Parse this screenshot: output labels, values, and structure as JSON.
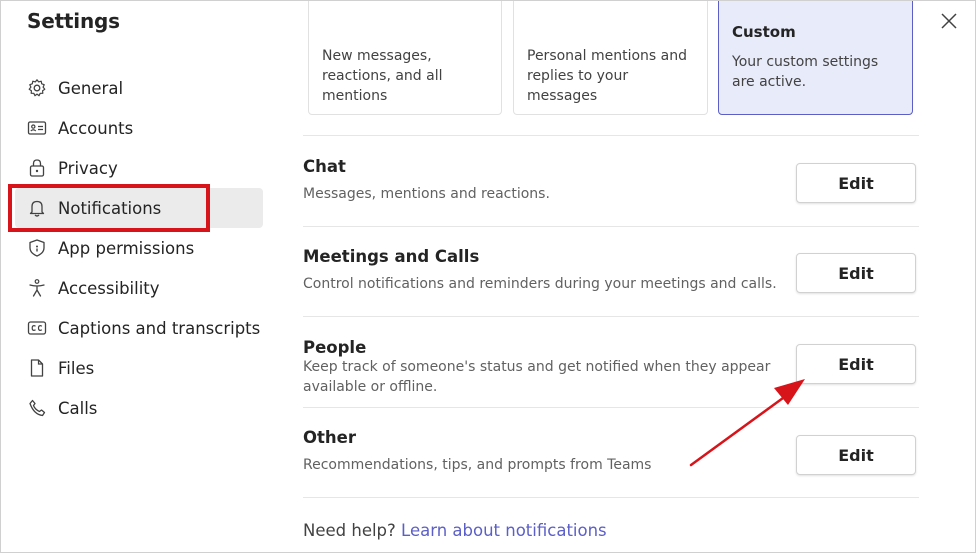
{
  "window": {
    "title": "Settings"
  },
  "sidebar": {
    "items": [
      {
        "label": "General",
        "icon": "gear-icon"
      },
      {
        "label": "Accounts",
        "icon": "id-card-icon"
      },
      {
        "label": "Privacy",
        "icon": "lock-icon"
      },
      {
        "label": "Notifications",
        "icon": "bell-icon",
        "active": true
      },
      {
        "label": "App permissions",
        "icon": "shield-icon"
      },
      {
        "label": "Accessibility",
        "icon": "accessibility-icon"
      },
      {
        "label": "Captions and transcripts",
        "icon": "cc-icon"
      },
      {
        "label": "Files",
        "icon": "file-icon"
      },
      {
        "label": "Calls",
        "icon": "phone-icon"
      }
    ]
  },
  "presets": [
    {
      "title": "",
      "description": "New messages, reactions, and all mentions"
    },
    {
      "title": "",
      "description": "Personal mentions and replies to your messages"
    },
    {
      "title": "Custom",
      "description": "Your custom settings are active.",
      "selected": true
    }
  ],
  "sections": [
    {
      "title": "Chat",
      "description": "Messages, mentions and reactions.",
      "button": "Edit"
    },
    {
      "title": "Meetings and Calls",
      "description": "Control notifications and reminders during your meetings and calls.",
      "button": "Edit"
    },
    {
      "title": "People",
      "description": "Keep track of someone's status and get notified when they appear available or offline.",
      "button": "Edit"
    },
    {
      "title": "Other",
      "description": "Recommendations, tips, and prompts from Teams",
      "button": "Edit"
    }
  ],
  "help": {
    "text": "Need help?",
    "link": "Learn about notifications"
  },
  "colors": {
    "accent": "#5b5fc7",
    "highlight": "#d7141a",
    "selected_card_bg": "#e8ebfa",
    "active_nav_bg": "#ebebeb"
  }
}
